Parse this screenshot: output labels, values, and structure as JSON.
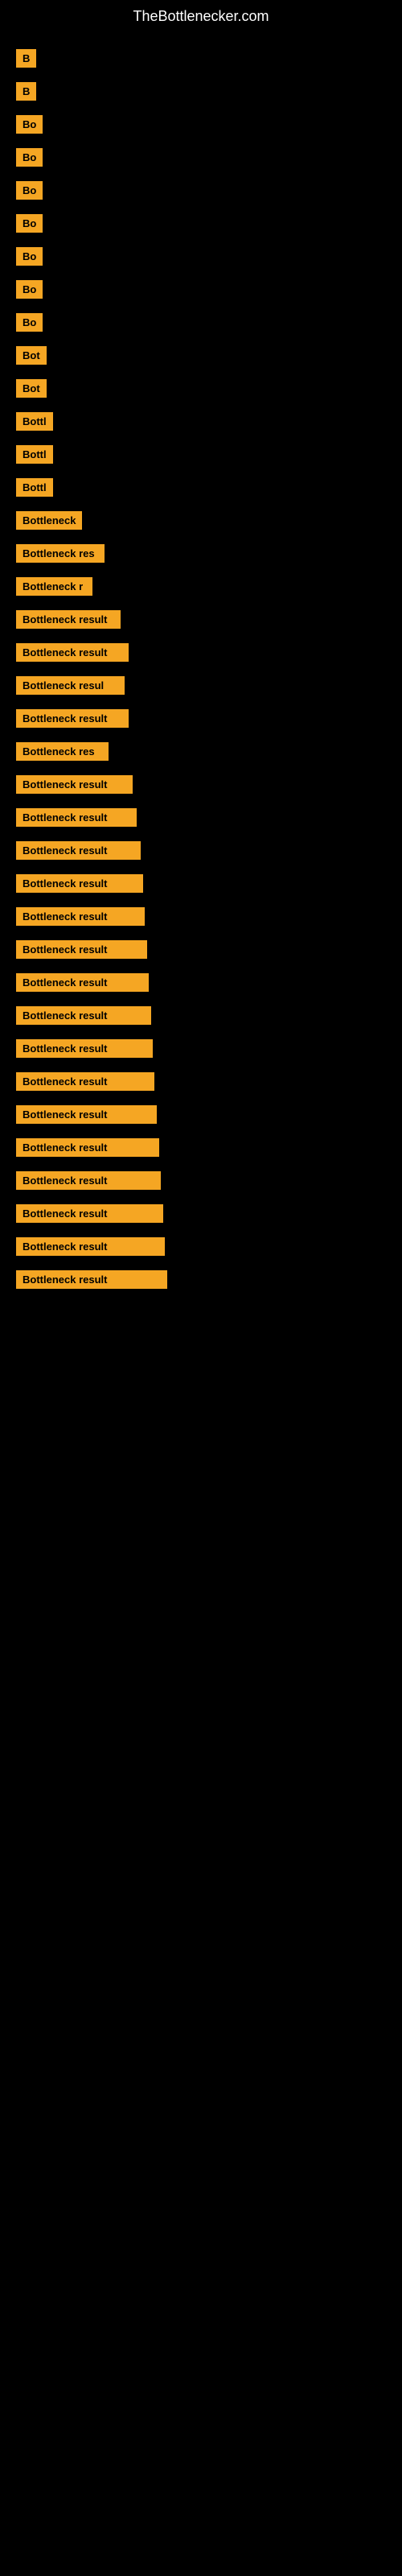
{
  "site": {
    "title": "TheBottlenecker.com"
  },
  "results": [
    {
      "id": 1,
      "label": "B",
      "width": 14
    },
    {
      "id": 2,
      "label": "B",
      "width": 14
    },
    {
      "id": 3,
      "label": "Bo",
      "width": 20
    },
    {
      "id": 4,
      "label": "Bo",
      "width": 20
    },
    {
      "id": 5,
      "label": "Bo",
      "width": 20
    },
    {
      "id": 6,
      "label": "Bo",
      "width": 20
    },
    {
      "id": 7,
      "label": "Bo",
      "width": 20
    },
    {
      "id": 8,
      "label": "Bo",
      "width": 20
    },
    {
      "id": 9,
      "label": "Bo",
      "width": 20
    },
    {
      "id": 10,
      "label": "Bot",
      "width": 26
    },
    {
      "id": 11,
      "label": "Bot",
      "width": 26
    },
    {
      "id": 12,
      "label": "Bottl",
      "width": 38
    },
    {
      "id": 13,
      "label": "Bottl",
      "width": 38
    },
    {
      "id": 14,
      "label": "Bottl",
      "width": 38
    },
    {
      "id": 15,
      "label": "Bottleneck",
      "width": 80
    },
    {
      "id": 16,
      "label": "Bottleneck res",
      "width": 110
    },
    {
      "id": 17,
      "label": "Bottleneck r",
      "width": 95
    },
    {
      "id": 18,
      "label": "Bottleneck result",
      "width": 130
    },
    {
      "id": 19,
      "label": "Bottleneck result",
      "width": 140
    },
    {
      "id": 20,
      "label": "Bottleneck resul",
      "width": 135
    },
    {
      "id": 21,
      "label": "Bottleneck result",
      "width": 140
    },
    {
      "id": 22,
      "label": "Bottleneck res",
      "width": 115
    },
    {
      "id": 23,
      "label": "Bottleneck result",
      "width": 145
    },
    {
      "id": 24,
      "label": "Bottleneck result",
      "width": 150
    },
    {
      "id": 25,
      "label": "Bottleneck result",
      "width": 155
    },
    {
      "id": 26,
      "label": "Bottleneck result",
      "width": 158
    },
    {
      "id": 27,
      "label": "Bottleneck result",
      "width": 160
    },
    {
      "id": 28,
      "label": "Bottleneck result",
      "width": 163
    },
    {
      "id": 29,
      "label": "Bottleneck result",
      "width": 165
    },
    {
      "id": 30,
      "label": "Bottleneck result",
      "width": 168
    },
    {
      "id": 31,
      "label": "Bottleneck result",
      "width": 170
    },
    {
      "id": 32,
      "label": "Bottleneck result",
      "width": 172
    },
    {
      "id": 33,
      "label": "Bottleneck result",
      "width": 175
    },
    {
      "id": 34,
      "label": "Bottleneck result",
      "width": 178
    },
    {
      "id": 35,
      "label": "Bottleneck result",
      "width": 180
    },
    {
      "id": 36,
      "label": "Bottleneck result",
      "width": 183
    },
    {
      "id": 37,
      "label": "Bottleneck result",
      "width": 185
    },
    {
      "id": 38,
      "label": "Bottleneck result",
      "width": 188
    }
  ]
}
